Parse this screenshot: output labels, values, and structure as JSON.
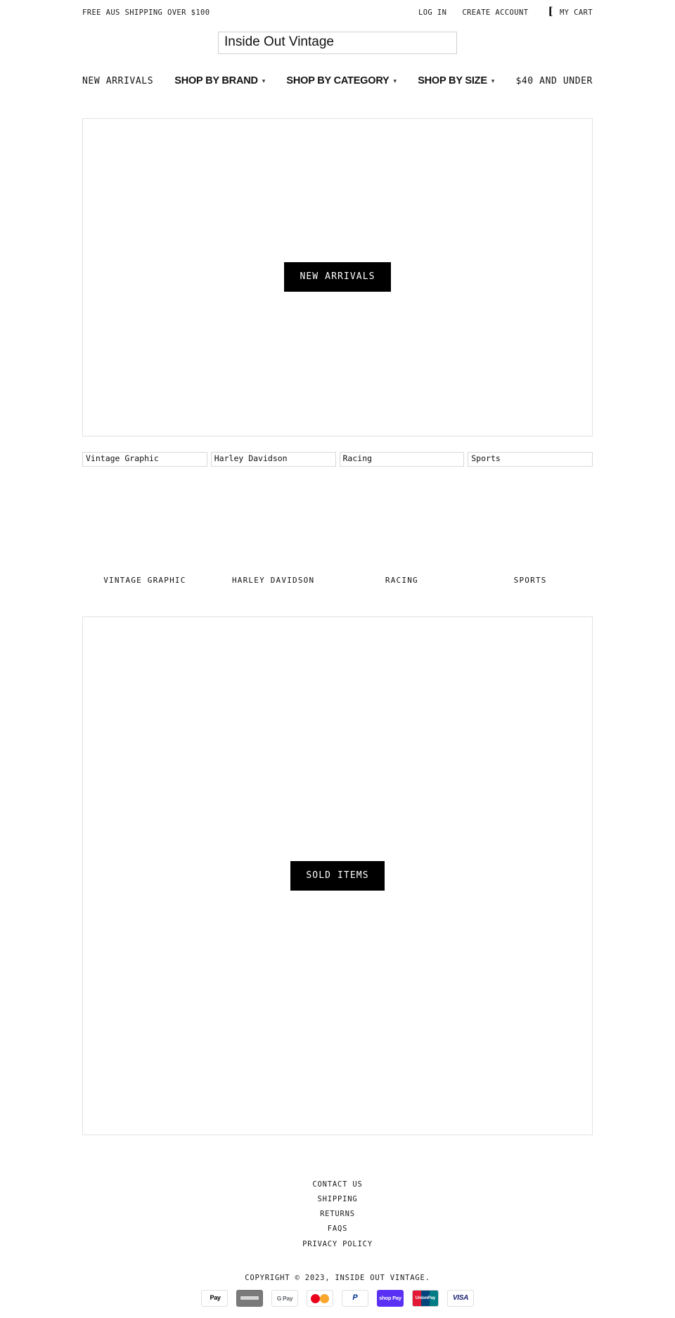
{
  "utility_bar": {
    "promo": "FREE AUS SHIPPING OVER $100",
    "log_in": "LOG IN",
    "create_account": "CREATE ACCOUNT",
    "cart_icon": "cart-icon",
    "cart_glyph": "[",
    "my_cart": "MY CART"
  },
  "header": {
    "logo_alt": "Inside Out Vintage"
  },
  "nav": {
    "items": [
      {
        "label": "NEW ARRIVALS",
        "style": "mono",
        "caret": ""
      },
      {
        "label": "SHOP BY BRAND",
        "style": "sans",
        "caret": "▾"
      },
      {
        "label": "SHOP BY CATEGORY",
        "style": "sans",
        "caret": "▾"
      },
      {
        "label": "SHOP BY SIZE",
        "style": "sans",
        "caret": "▾"
      },
      {
        "label": "$40 AND UNDER",
        "style": "mono",
        "caret": ""
      }
    ]
  },
  "hero_primary": {
    "cta_label": "NEW ARRIVALS"
  },
  "collections": [
    {
      "alt": "Vintage Graphic",
      "title": "VINTAGE GRAPHIC"
    },
    {
      "alt": "Harley Davidson",
      "title": "HARLEY DAVIDSON"
    },
    {
      "alt": "Racing",
      "title": "RACING"
    },
    {
      "alt": "Sports",
      "title": "SPORTS"
    }
  ],
  "hero_secondary": {
    "cta_label": "SOLD ITEMS"
  },
  "footer": {
    "links": [
      "CONTACT US",
      "SHIPPING",
      "RETURNS",
      "FAQS",
      "PRIVACY POLICY"
    ],
    "copyright": "COPYRIGHT © 2023, INSIDE OUT VINTAGE.",
    "payment_methods": [
      {
        "name": "apple-pay",
        "label": " Pay"
      },
      {
        "name": "amex",
        "label": ""
      },
      {
        "name": "google-pay",
        "label": "G Pay"
      },
      {
        "name": "mastercard",
        "label": ""
      },
      {
        "name": "paypal",
        "label": "P"
      },
      {
        "name": "shop-pay",
        "label": "shop Pay"
      },
      {
        "name": "unionpay",
        "label": "UnionPay"
      },
      {
        "name": "visa",
        "label": "VISA"
      }
    ]
  },
  "colors": {
    "accent": "#000000",
    "text": "#1a1a1a",
    "border": "#e2e2e2"
  }
}
